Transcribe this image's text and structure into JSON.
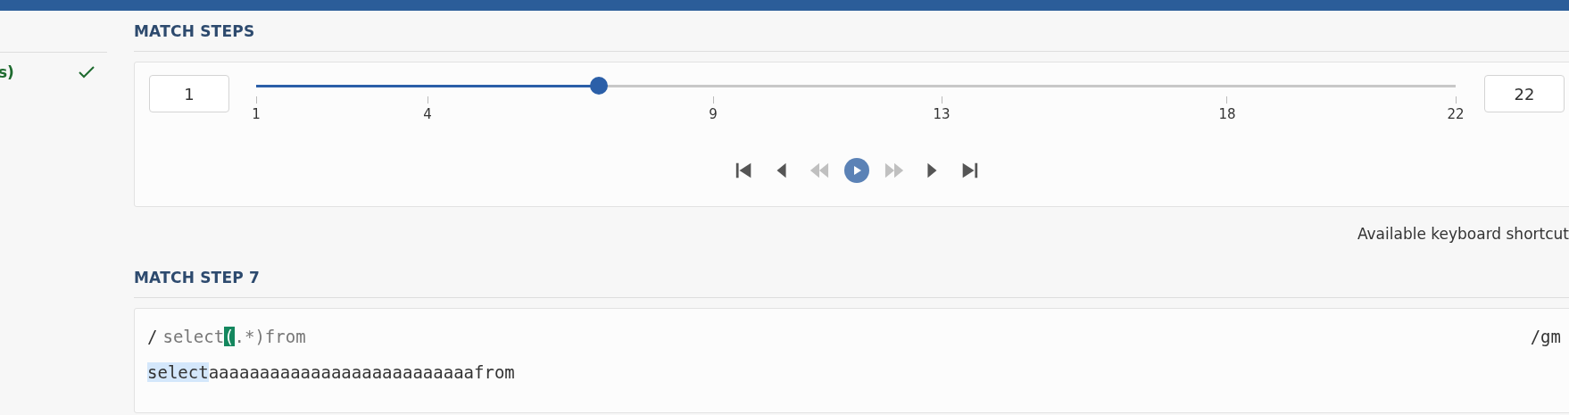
{
  "sidebar": {
    "items": [
      {
        "label": "s)",
        "completed": true
      }
    ]
  },
  "match_steps": {
    "title": "MATCH STEPS",
    "start_field": "1",
    "end_field": "22",
    "slider": {
      "level": 0.2857,
      "ticks": [
        {
          "label": "1"
        },
        {
          "label": "4"
        },
        {
          "label": "9"
        },
        {
          "label": "13"
        },
        {
          "label": "18"
        },
        {
          "label": "22"
        }
      ]
    },
    "controls": [
      {
        "kind": "first",
        "disabled": false
      },
      {
        "kind": "prev",
        "disabled": false
      },
      {
        "kind": "rewind",
        "disabled": true
      },
      {
        "kind": "play",
        "disabled": false
      },
      {
        "kind": "forward",
        "disabled": true
      },
      {
        "kind": "next",
        "disabled": false
      },
      {
        "kind": "last",
        "disabled": false
      }
    ]
  },
  "shortcuts_link": "Available keyboard shortcut",
  "match_step": {
    "title": "MATCH STEP 7",
    "delimiter": "/",
    "pattern": [
      {
        "text": "select",
        "highlighted": false
      },
      {
        "text": "(",
        "highlighted": true
      },
      {
        "text": ".*)from",
        "highlighted": false
      }
    ],
    "flags": "/gm",
    "test_string": [
      {
        "text": "select",
        "matched": true
      },
      {
        "text": "aaaaaaaaaaaaaaaaaaaaaaaaaafrom",
        "matched": false
      }
    ]
  }
}
